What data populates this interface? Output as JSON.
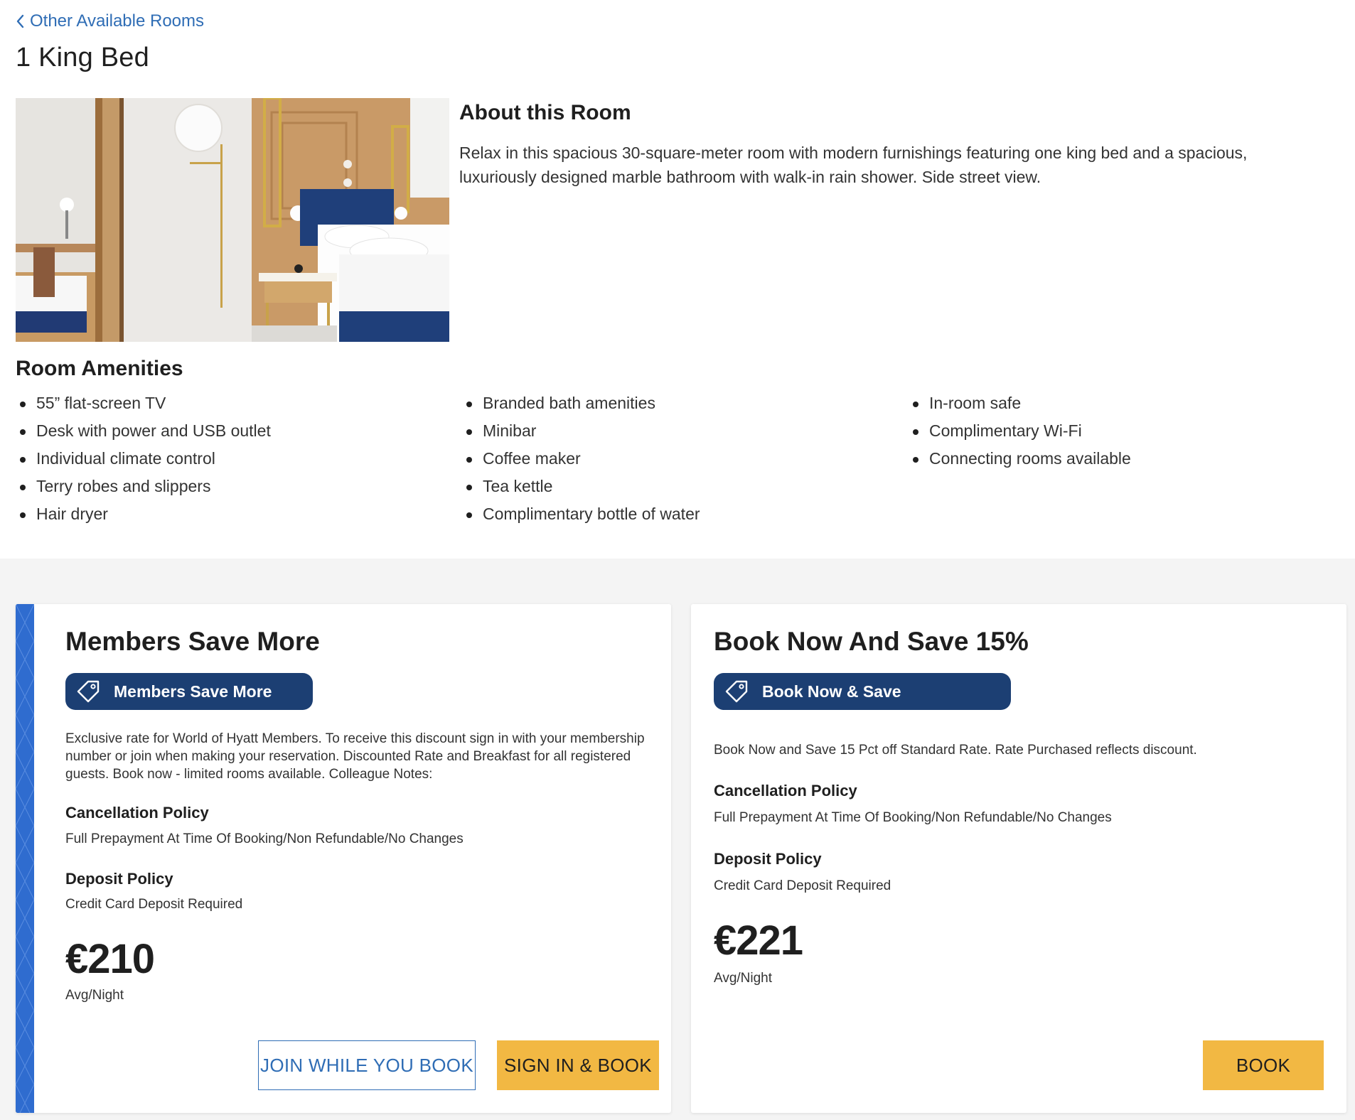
{
  "nav": {
    "back_label": "Other Available Rooms"
  },
  "room": {
    "title": "1 King Bed",
    "about_heading": "About this Room",
    "about_text": "Relax in this spacious 30-square-meter room with modern furnishings featuring one king bed and a spacious, luxuriously designed marble bathroom with walk-in rain shower. Side street view."
  },
  "amenities": {
    "heading": "Room Amenities",
    "col1": [
      "55” flat-screen TV",
      "Desk with power and USB outlet",
      "Individual climate control",
      "Terry robes and slippers",
      "Hair dryer"
    ],
    "col2": [
      "Branded bath amenities",
      "Minibar",
      "Coffee maker",
      "Tea kettle",
      "Complimentary bottle of water"
    ],
    "col3": [
      "In-room safe",
      "Complimentary Wi-Fi",
      "Connecting rooms available"
    ]
  },
  "rates": [
    {
      "title": "Members Save More",
      "badge": "Members Save More",
      "description": "Exclusive rate for World of Hyatt Members. To receive this discount sign in with your membership number or join when making your reservation. Discounted Rate and Breakfast for all registered guests. Book now - limited rooms available. Colleague Notes:",
      "cancellation_heading": "Cancellation Policy",
      "cancellation_text": "Full Prepayment At Time Of Booking/Non Refundable/No Changes",
      "deposit_heading": "Deposit Policy",
      "deposit_text": "Credit Card Deposit Required",
      "price": "€210",
      "price_unit": "Avg/Night",
      "join_label": "JOIN WHILE YOU BOOK",
      "signin_label": "SIGN IN & BOOK"
    },
    {
      "title": "Book Now And Save 15%",
      "badge": "Book Now & Save",
      "description": "Book Now and Save 15 Pct off Standard Rate. Rate Purchased reflects discount.",
      "cancellation_heading": "Cancellation Policy",
      "cancellation_text": "Full Prepayment At Time Of Booking/Non Refundable/No Changes",
      "deposit_heading": "Deposit Policy",
      "deposit_text": "Credit Card Deposit Required",
      "price": "€221",
      "price_unit": "Avg/Night",
      "book_label": "BOOK"
    }
  ],
  "icons": {
    "back": "chevron-left-icon",
    "tag": "price-tag-icon"
  },
  "colors": {
    "link": "#2f6db5",
    "badge_bg": "#1c3f73",
    "button_yellow": "#f2b843",
    "member_stripe": "#2f6ccf",
    "page_gray": "#f4f4f4"
  }
}
